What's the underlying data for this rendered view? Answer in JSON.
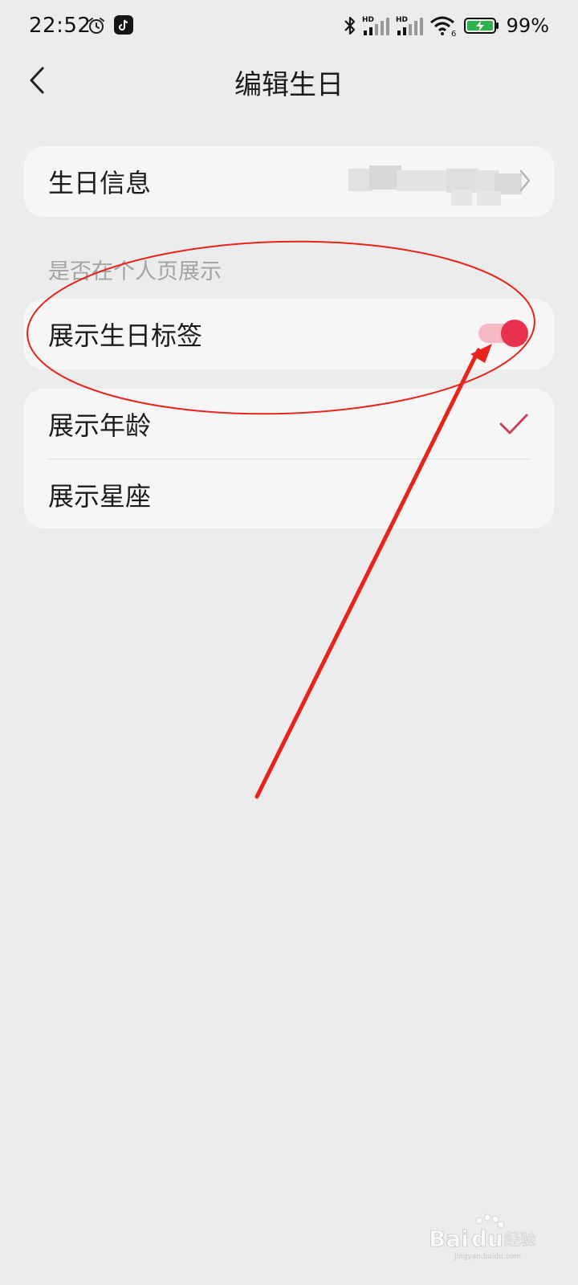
{
  "status_bar": {
    "time": "22:52",
    "battery_percent": "99%",
    "signal_label_1": "HD",
    "signal_label_2": "HD",
    "wifi_label": "6"
  },
  "nav": {
    "title": "编辑生日"
  },
  "birthday_info": {
    "label": "生日信息"
  },
  "display_section": {
    "header": "是否在个人页展示",
    "toggle_label": "展示生日标签",
    "toggle_on": true
  },
  "options": [
    {
      "label": "展示年龄",
      "checked": true
    },
    {
      "label": "展示星座",
      "checked": false
    }
  ],
  "colors": {
    "accent": "#e8304f",
    "accent_light": "#f5b9c3",
    "annotation_red": "#e8231a",
    "background": "#ececec",
    "card": "#f6f6f6"
  },
  "watermark": {
    "brand": "Bai",
    "brand2": "du",
    "suffix": "经验",
    "url": "jingyan.baidu.com"
  }
}
